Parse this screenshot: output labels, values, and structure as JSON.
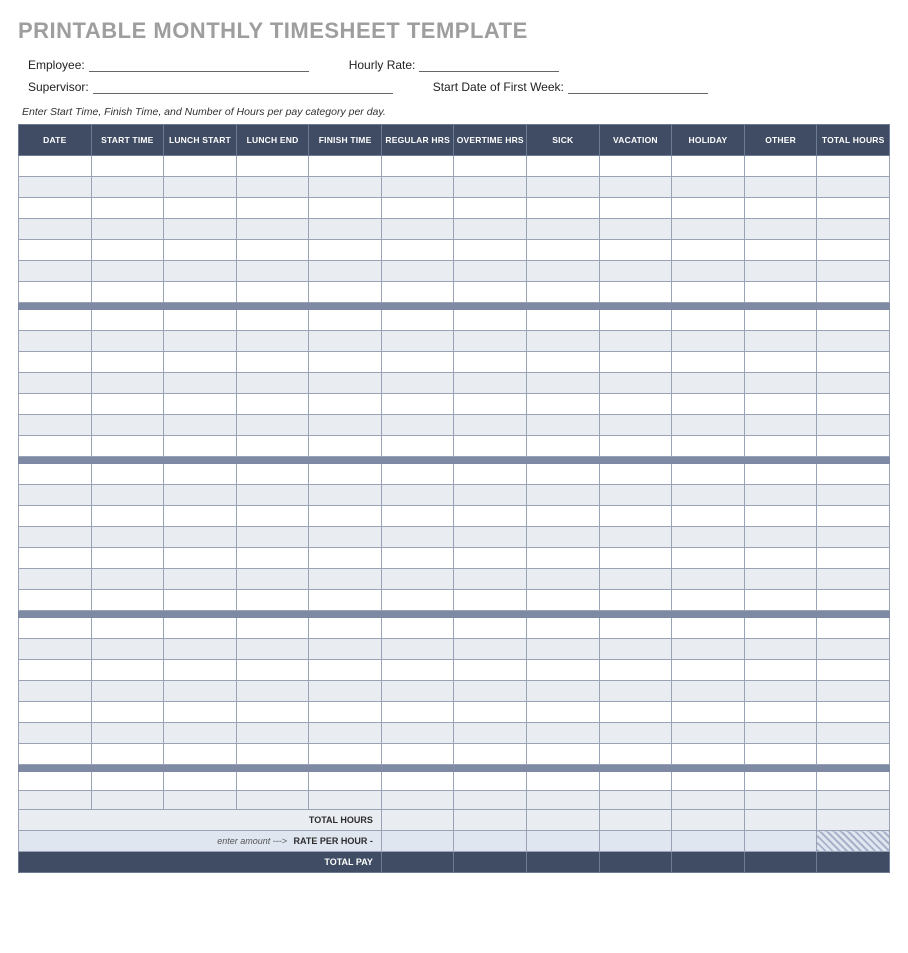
{
  "title": "PRINTABLE MONTHLY TIMESHEET TEMPLATE",
  "info": {
    "employee_label": "Employee:",
    "hourly_rate_label": "Hourly Rate:",
    "supervisor_label": "Supervisor:",
    "start_date_label": "Start Date of First Week:"
  },
  "instruction": "Enter Start Time, Finish Time, and Number of Hours per pay category per day.",
  "columns": [
    "DATE",
    "START TIME",
    "LUNCH START",
    "LUNCH END",
    "FINISH TIME",
    "REGULAR HRS",
    "OVERTIME HRS",
    "SICK",
    "VACATION",
    "HOLIDAY",
    "OTHER",
    "TOTAL HOURS"
  ],
  "weeks": 4,
  "days_per_week": 7,
  "extra_rows": 2,
  "summary": {
    "total_hours_label": "TOTAL HOURS",
    "rate_hint": "enter amount --->",
    "rate_label": "RATE PER HOUR -",
    "total_pay_label": "TOTAL PAY"
  }
}
